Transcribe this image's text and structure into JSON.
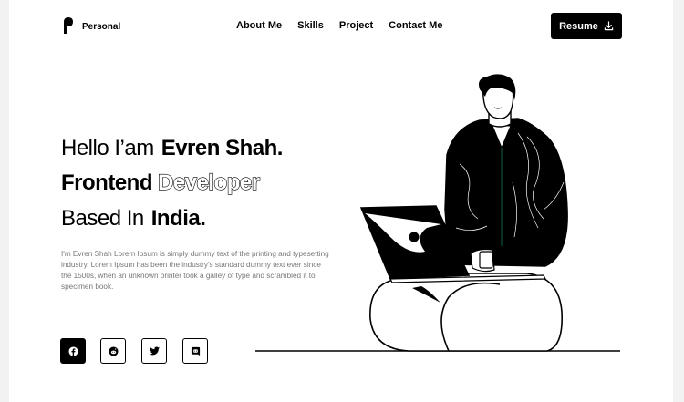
{
  "brand": {
    "name": "Personal",
    "logo_icon": "logo-mark-icon"
  },
  "nav": {
    "items": [
      {
        "label": "About Me"
      },
      {
        "label": "Skills"
      },
      {
        "label": "Project"
      },
      {
        "label": "Contact Me"
      }
    ]
  },
  "resume": {
    "label": "Resume",
    "icon": "download-icon"
  },
  "hero": {
    "line1_light": "Hello I’am",
    "line1_bold": "Evren Shah.",
    "line2_bold": "Frontend",
    "line2_outline": "Developer",
    "line3_light": "Based In",
    "line3_bold": "India.",
    "description": "I'm Evren Shah Lorem Ipsum is simply dummy text of the printing and typesetting industry. Lorem Ipsum has been the industry's standard dummy text ever since the 1500s, when an unknown printer took a galley of type and scrambled it to specimen book."
  },
  "social": [
    {
      "icon": "facebook-icon",
      "filled": true
    },
    {
      "icon": "reddit-icon",
      "filled": false
    },
    {
      "icon": "twitter-icon",
      "filled": false
    },
    {
      "icon": "discord-icon",
      "filled": false
    }
  ],
  "colors": {
    "primary": "#000000",
    "background": "#ffffff",
    "outer": "#f2f2f2",
    "muted": "#777777"
  }
}
